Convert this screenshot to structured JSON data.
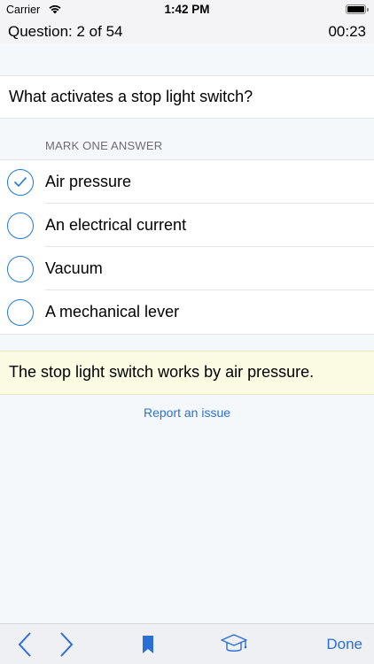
{
  "status_bar": {
    "carrier": "Carrier",
    "time": "1:42 PM"
  },
  "quiz_header": {
    "question_counter": "Question: 2 of 54",
    "timer": "00:23"
  },
  "question": {
    "text": "What activates a stop light switch?"
  },
  "answers_section": {
    "label": "MARK ONE ANSWER",
    "items": [
      {
        "label": "Air pressure",
        "selected": true
      },
      {
        "label": "An electrical current",
        "selected": false
      },
      {
        "label": "Vacuum",
        "selected": false
      },
      {
        "label": "A mechanical lever",
        "selected": false
      }
    ]
  },
  "explanation": {
    "text": "The stop light switch works by air pressure."
  },
  "report_link": "Report an issue",
  "toolbar": {
    "prev_icon": "chevron-left-icon",
    "next_icon": "chevron-right-icon",
    "bookmark_icon": "bookmark-icon",
    "study_icon": "graduation-cap-icon",
    "done_label": "Done"
  },
  "colors": {
    "accent": "#2b6fd6",
    "radio": "#1d7ad8",
    "explanation_bg": "#fbfbe3",
    "page_bg": "#f4f8fb"
  }
}
